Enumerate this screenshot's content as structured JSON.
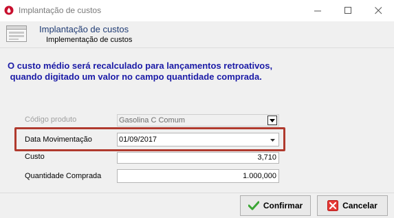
{
  "window": {
    "title": "Implantação de custos"
  },
  "header": {
    "title": "Implantação de custos",
    "subtitle": "Implementação de custos"
  },
  "notice": "O custo médio será recalculado para lançamentos retroativos,\n quando digitado um valor no campo quantidade comprada.",
  "form": {
    "produto_label": "Código produto",
    "produto_value": "Gasolina C Comum",
    "data_label": "Data Movimentação",
    "data_value": "01/09/2017",
    "custo_label": "Custo",
    "custo_value": "3,710",
    "quantidade_label": "Quantidade Comprada",
    "quantidade_value": "1.000,000"
  },
  "buttons": {
    "confirm": "Confirmar",
    "cancel": "Cancelar"
  },
  "colors": {
    "highlight": "#b03a2e",
    "notice_text": "#1a1aa6",
    "header_title": "#1f3b73"
  }
}
